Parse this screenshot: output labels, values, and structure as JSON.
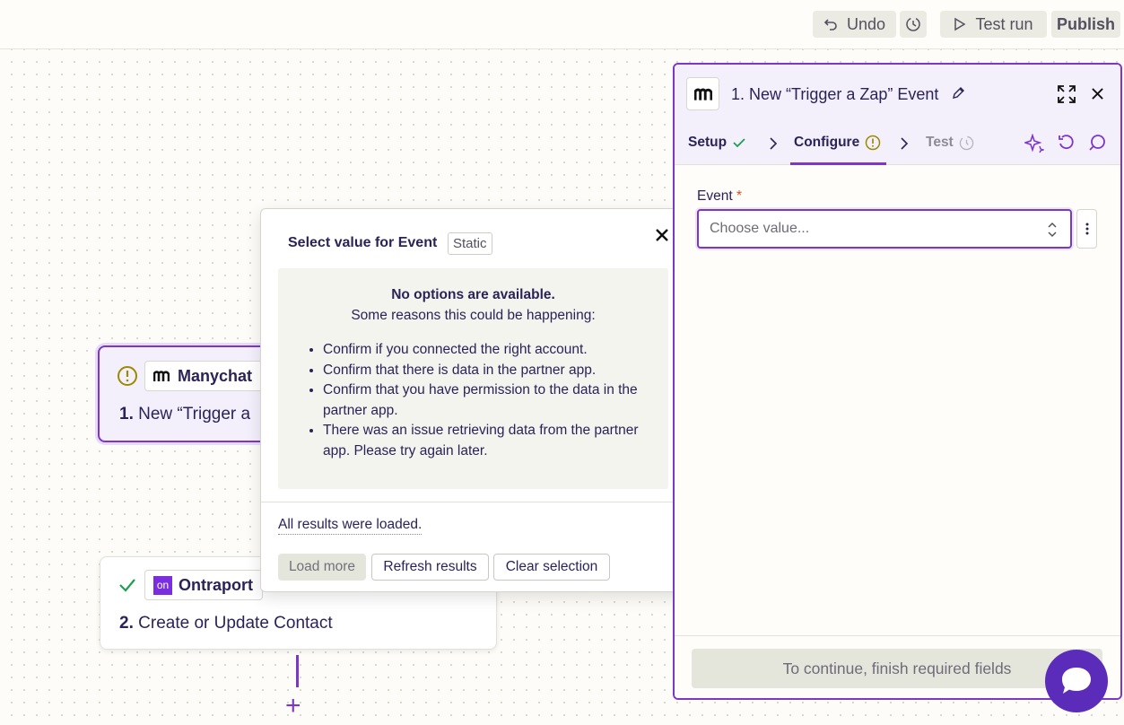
{
  "topbar": {
    "undo_label": "Undo",
    "test_run_label": "Test run",
    "publish_label": "Publish"
  },
  "canvas": {
    "step1": {
      "app": "Manychat",
      "number": "1.",
      "title": "New “Trigger a",
      "status": "warning"
    },
    "step2": {
      "app": "Ontraport",
      "number": "2.",
      "title": "Create or Update Contact",
      "status": "complete",
      "app_logo_text": "on"
    },
    "add_step_label": "+"
  },
  "popover": {
    "title": "Select value for Event",
    "badge": "Static",
    "heading": "No options are available.",
    "subheading": "Some reasons this could be happening:",
    "reasons": [
      "Confirm if you connected the right account.",
      "Confirm that there is data in the partner app.",
      "Confirm that you have permission to the data in the partner app.",
      "There was an issue retrieving data from the partner app. Please try again later."
    ],
    "status": "All results were loaded.",
    "load_more_label": "Load more",
    "refresh_label": "Refresh results",
    "clear_label": "Clear selection"
  },
  "panel": {
    "title": "1. New “Trigger a Zap” Event",
    "tabs": [
      {
        "label": "Setup",
        "state": "complete"
      },
      {
        "label": "Configure",
        "state": "warning"
      },
      {
        "label": "Test",
        "state": "disabled"
      }
    ],
    "event_label": "Event",
    "required_mark": "*",
    "event_placeholder": "Choose value...",
    "continue_label": "To continue, finish required fields"
  },
  "colors": {
    "accent": "#7d37c8",
    "success": "#1f9e53",
    "warning": "#9a8a00",
    "chat": "#5b2bba"
  }
}
